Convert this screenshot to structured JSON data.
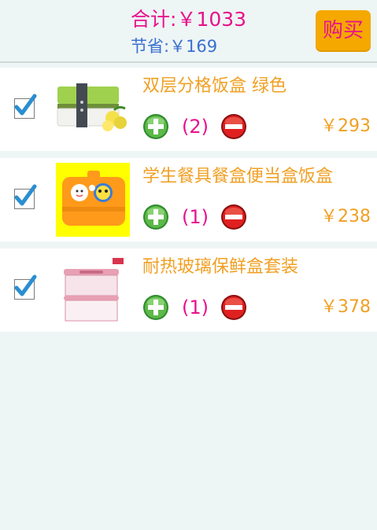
{
  "header": {
    "total_text": "合计:￥1033",
    "saved_text": "节省:￥169",
    "buy_label": "购买"
  },
  "items": [
    {
      "name": "双层分格饭盒 绿色",
      "qty": "(2)",
      "price": "￥293",
      "checked": true
    },
    {
      "name": "学生餐具餐盒便当盒饭盒",
      "qty": "(1)",
      "price": "￥238",
      "checked": true
    },
    {
      "name": "耐热玻璃保鲜盒套装",
      "qty": "(1)",
      "price": "￥378",
      "checked": true
    }
  ],
  "colors": {
    "accent_pink": "#e8118c",
    "accent_orange": "#f0a024",
    "saved_blue": "#3a6fd0",
    "buy_bg": "#f5a800"
  }
}
